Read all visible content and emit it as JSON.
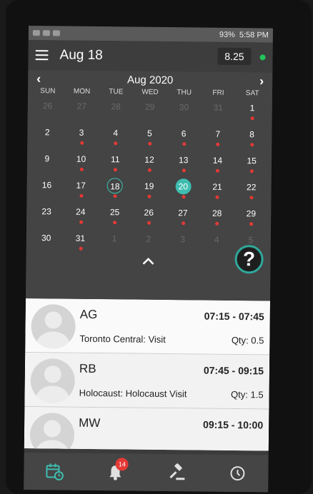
{
  "status_bar": {
    "battery": "93%",
    "time": "5:58 PM"
  },
  "header": {
    "title": "Aug 18",
    "version": "8.25"
  },
  "calendar": {
    "month_label": "Aug 2020",
    "prev_arrow": "‹",
    "next_arrow": "›",
    "weekdays": [
      "SUN",
      "MON",
      "TUE",
      "WED",
      "THU",
      "FRI",
      "SAT"
    ],
    "days": [
      {
        "n": "26",
        "m": true,
        "d": false
      },
      {
        "n": "27",
        "m": true,
        "d": false
      },
      {
        "n": "28",
        "m": true,
        "d": false
      },
      {
        "n": "29",
        "m": true,
        "d": false
      },
      {
        "n": "30",
        "m": true,
        "d": false
      },
      {
        "n": "31",
        "m": true,
        "d": false
      },
      {
        "n": "1",
        "m": false,
        "d": true
      },
      {
        "n": "2",
        "m": false,
        "d": false
      },
      {
        "n": "3",
        "m": false,
        "d": true
      },
      {
        "n": "4",
        "m": false,
        "d": true
      },
      {
        "n": "5",
        "m": false,
        "d": true
      },
      {
        "n": "6",
        "m": false,
        "d": true
      },
      {
        "n": "7",
        "m": false,
        "d": true
      },
      {
        "n": "8",
        "m": false,
        "d": true
      },
      {
        "n": "9",
        "m": false,
        "d": false
      },
      {
        "n": "10",
        "m": false,
        "d": true
      },
      {
        "n": "11",
        "m": false,
        "d": true
      },
      {
        "n": "12",
        "m": false,
        "d": true
      },
      {
        "n": "13",
        "m": false,
        "d": true
      },
      {
        "n": "14",
        "m": false,
        "d": true
      },
      {
        "n": "15",
        "m": false,
        "d": true
      },
      {
        "n": "16",
        "m": false,
        "d": false
      },
      {
        "n": "17",
        "m": false,
        "d": true
      },
      {
        "n": "18",
        "m": false,
        "d": true,
        "today": true
      },
      {
        "n": "19",
        "m": false,
        "d": true
      },
      {
        "n": "20",
        "m": false,
        "d": true,
        "sel": true
      },
      {
        "n": "21",
        "m": false,
        "d": true
      },
      {
        "n": "22",
        "m": false,
        "d": true
      },
      {
        "n": "23",
        "m": false,
        "d": false
      },
      {
        "n": "24",
        "m": false,
        "d": true
      },
      {
        "n": "25",
        "m": false,
        "d": true
      },
      {
        "n": "26",
        "m": false,
        "d": true
      },
      {
        "n": "27",
        "m": false,
        "d": true
      },
      {
        "n": "28",
        "m": false,
        "d": true
      },
      {
        "n": "29",
        "m": false,
        "d": true
      },
      {
        "n": "30",
        "m": false,
        "d": false
      },
      {
        "n": "31",
        "m": false,
        "d": true
      },
      {
        "n": "1",
        "m": true,
        "d": false
      },
      {
        "n": "2",
        "m": true,
        "d": false
      },
      {
        "n": "3",
        "m": true,
        "d": false
      },
      {
        "n": "4",
        "m": true,
        "d": false
      },
      {
        "n": "5",
        "m": true,
        "d": false
      }
    ],
    "collapse_label": "^",
    "help_label": "?"
  },
  "appointments": [
    {
      "initials": "AG",
      "time": "07:15 - 07:45",
      "desc": "Toronto Central: Visit",
      "qty": "Qty: 0.5"
    },
    {
      "initials": "RB",
      "time": "07:45 - 09:15",
      "desc": "Holocaust: Holocaust Visit",
      "qty": "Qty: 1.5"
    },
    {
      "initials": "MW",
      "time": "09:15 - 10:00",
      "desc": "",
      "qty": ""
    }
  ],
  "bottom_nav": {
    "notification_count": "14"
  },
  "colors": {
    "accent": "#3ebdb0",
    "dot": "#e53935",
    "online": "#21c45a"
  }
}
